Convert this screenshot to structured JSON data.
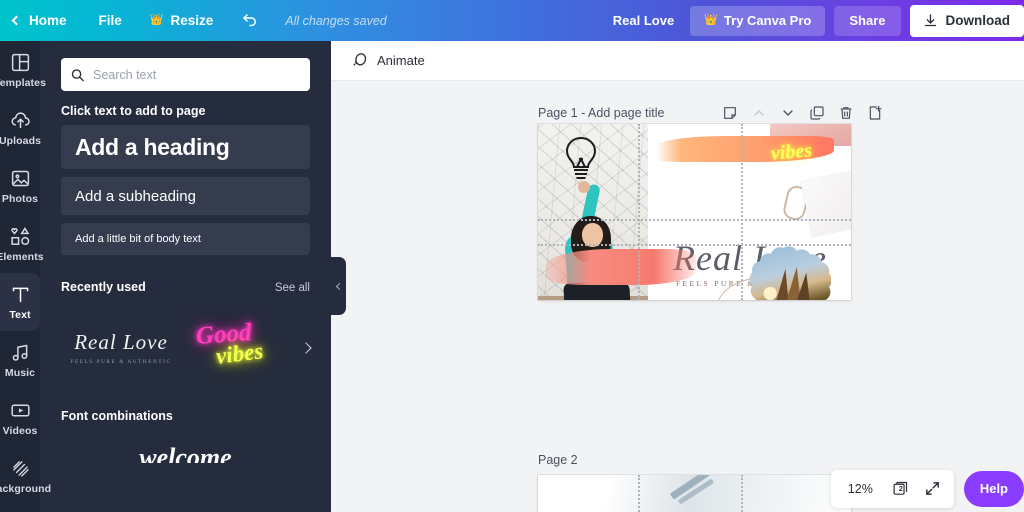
{
  "topbar": {
    "back_icon": "chevron-left-icon",
    "home_label": "Home",
    "file_label": "File",
    "resize_label": "Resize",
    "resize_icon": "crown-icon",
    "undo_icon": "undo-icon",
    "save_status": "All changes saved",
    "doc_name": "Real Love",
    "pro_label": "Try Canva Pro",
    "pro_icon": "crown-icon",
    "share_label": "Share",
    "download_label": "Download",
    "download_icon": "download-icon",
    "gradient_start": "#00c4cc",
    "gradient_end": "#7d2ae8"
  },
  "rail": {
    "items": [
      {
        "label": "Templates",
        "icon": "templates-icon",
        "active": false
      },
      {
        "label": "Uploads",
        "icon": "upload-cloud-icon",
        "active": false
      },
      {
        "label": "Photos",
        "icon": "image-icon",
        "active": false
      },
      {
        "label": "Elements",
        "icon": "shapes-icon",
        "active": false
      },
      {
        "label": "Text",
        "icon": "text-t-icon",
        "active": true
      },
      {
        "label": "Music",
        "icon": "music-note-icon",
        "active": false
      },
      {
        "label": "Videos",
        "icon": "video-icon",
        "active": false
      },
      {
        "label": "Background",
        "icon": "hatch-icon",
        "active": false
      }
    ]
  },
  "panel": {
    "search": {
      "placeholder": "Search text",
      "value": "",
      "icon": "search-icon"
    },
    "click_caption": "Click text to add to page",
    "text_options": [
      {
        "label": "Add a heading"
      },
      {
        "label": "Add a subheading"
      },
      {
        "label": "Add a little bit of body text"
      }
    ],
    "recently_used": {
      "title": "Recently used",
      "see_all": "See all",
      "next_icon": "chevron-right-icon",
      "items": [
        {
          "title": "Real Love",
          "subtitle": "FEELS PURE & AUTHENTIC"
        },
        {
          "word1": "Good",
          "word2": "vibes"
        }
      ]
    },
    "font_combinations": {
      "title": "Font combinations",
      "preview_word": "welcome"
    },
    "collapse_icon": "chevron-left-icon"
  },
  "editor": {
    "context_bar": {
      "animate_label": "Animate",
      "animate_icon": "animate-icon"
    },
    "page1": {
      "label": "Page 1 - Add page title",
      "tools": [
        {
          "name": "notes-icon"
        },
        {
          "name": "chevron-up-icon"
        },
        {
          "name": "chevron-down-icon"
        },
        {
          "name": "duplicate-icon"
        },
        {
          "name": "trash-icon"
        },
        {
          "name": "add-page-icon"
        }
      ],
      "design": {
        "title": "Real Love",
        "subtitle": "FEELS PURE & AUTHENTIC",
        "neon_word": "vibes"
      }
    },
    "page2": {
      "label": "Page 2"
    }
  },
  "bottom": {
    "zoom_level": "12%",
    "page_count": "2",
    "pages_icon": "pages-icon",
    "fullscreen_icon": "expand-icon",
    "help_label": "Help"
  }
}
